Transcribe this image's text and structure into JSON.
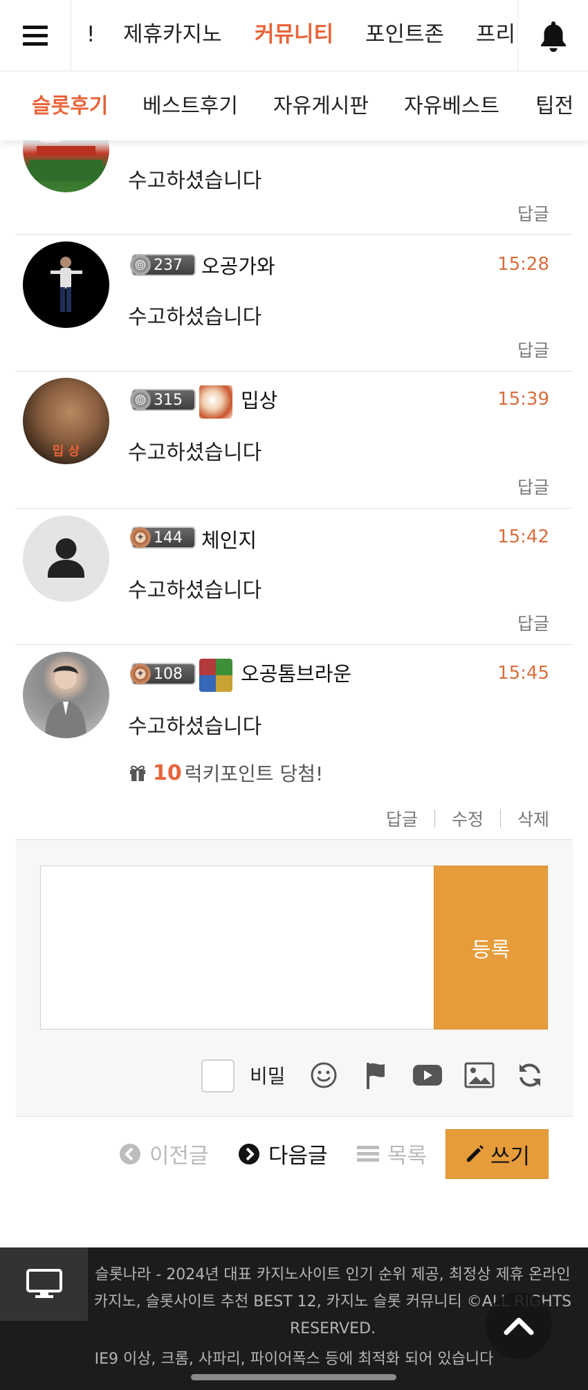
{
  "top_nav": {
    "items": [
      "!",
      "제휴카지노",
      "커뮤니티",
      "포인트존",
      "프리"
    ],
    "active_index": 2
  },
  "sub_nav": {
    "items": [
      "슬롯후기",
      "베스트후기",
      "자유게시판",
      "자유베스트",
      "팁전"
    ],
    "active_index": 0
  },
  "colors": {
    "accent": "#e8643a",
    "button": "#e79c3b",
    "time": "#d86d3c",
    "footer_bg": "#1c1c1c"
  },
  "comments": [
    {
      "text": "수고하셨습니다",
      "reply_label": "답글"
    },
    {
      "level": "237",
      "nickname": "오공가와",
      "time": "15:28",
      "text": "수고하셨습니다",
      "reply_label": "답글"
    },
    {
      "level": "315",
      "nickname": "밉상",
      "avatar_caption": "밉 상",
      "time": "15:39",
      "text": "수고하셨습니다",
      "reply_label": "답글"
    },
    {
      "level": "144",
      "nickname": "체인지",
      "time": "15:42",
      "text": "수고하셨습니다",
      "reply_label": "답글"
    },
    {
      "level": "108",
      "nickname": "오공톰브라운",
      "time": "15:45",
      "text": "수고하셨습니다",
      "luck_points": "10",
      "luck_text": "럭키포인트 당첨!",
      "actions": [
        "답글",
        "수정",
        "삭제"
      ]
    }
  ],
  "write_box": {
    "submit_label": "등록",
    "secret_label": "비밀",
    "tool_icons": [
      "smile-icon",
      "flag-icon",
      "youtube-icon",
      "image-icon",
      "refresh-icon"
    ]
  },
  "post_nav": {
    "prev_label": "이전글",
    "next_label": "다음글",
    "list_label": "목록",
    "write_label": "쓰기"
  },
  "footer": {
    "text": "슬롯나라 - 2024년 대표 카지노사이트 인기 순위 제공, 최정상 제휴 온라인 카지노, 슬롯사이트 추천 BEST 12, 카지노 슬롯 커뮤니티 ©ALL RIGHTS RESERVED.",
    "note": "IE9 이상, 크롬, 사파리, 파이어폭스 등에 최적화 되어 있습니다"
  }
}
